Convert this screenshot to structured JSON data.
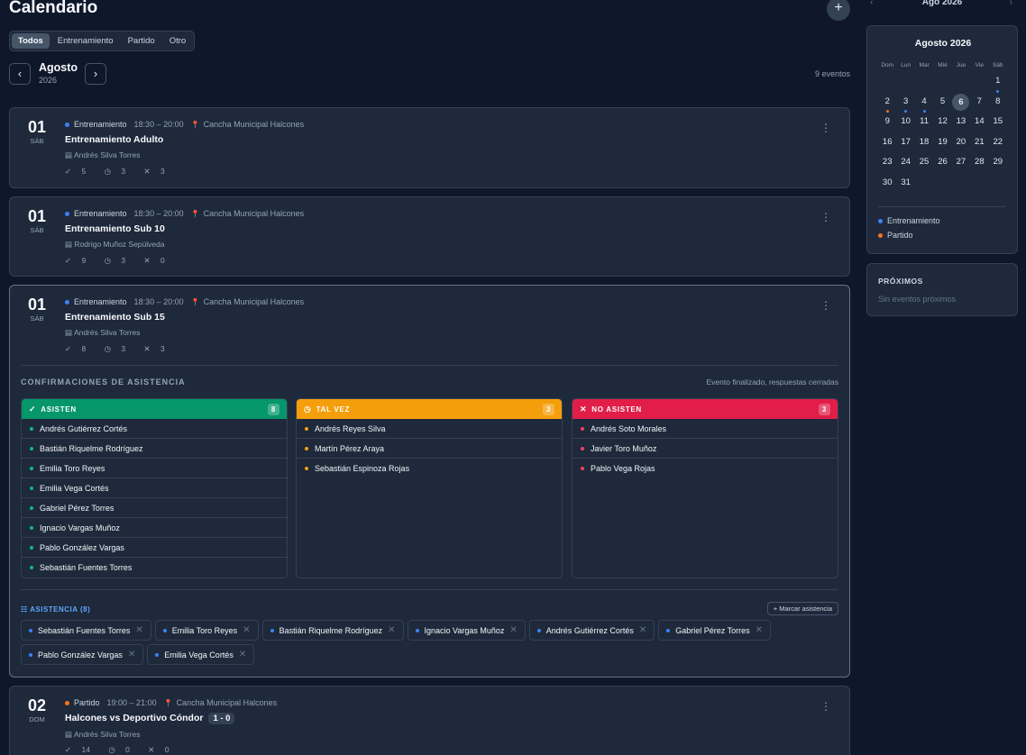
{
  "header": {
    "title": "Calendario",
    "add_label": "+"
  },
  "filters": [
    "Todos",
    "Entrenamiento",
    "Partido",
    "Otro"
  ],
  "nav": {
    "prev": "‹",
    "next": "›",
    "month": "Agosto",
    "year": "2026",
    "count": "9 eventos"
  },
  "colors": {
    "training": "#3b82f6",
    "match": "#f97316",
    "yes": "#059669",
    "maybe": "#f59e0b",
    "no": "#e11d48"
  },
  "events": [
    {
      "day": "01",
      "weekday": "SÁB",
      "type": "Entrenamiento",
      "time": "18:30 – 20:00",
      "place": "Cancha Municipal Halcones",
      "title": "Entrenamiento Adulto",
      "coach": "Andrés Silva Torres",
      "yes": "5",
      "maybe": "3",
      "no": "3"
    },
    {
      "day": "01",
      "weekday": "SÁB",
      "type": "Entrenamiento",
      "time": "18:30 – 20:00",
      "place": "Cancha Municipal Halcones",
      "title": "Entrenamiento Sub 10",
      "coach": "Rodrigo Muñoz Sepúlveda",
      "yes": "9",
      "maybe": "3",
      "no": "0"
    },
    {
      "day": "01",
      "weekday": "SÁB",
      "type": "Entrenamiento",
      "time": "18:30 – 20:00",
      "place": "Cancha Municipal Halcones",
      "title": "Entrenamiento Sub 15",
      "coach": "Andrés Silva Torres",
      "yes": "8",
      "maybe": "3",
      "no": "3"
    },
    {
      "day": "02",
      "weekday": "DOM",
      "type": "Partido",
      "time": "19:00 – 21:00",
      "place": "Cancha Municipal Halcones",
      "title": "Halcones vs Deportivo Cóndor",
      "score": "1 - 0",
      "coach": "Andrés Silva Torres",
      "yes": "14",
      "maybe": "0",
      "no": "0"
    }
  ],
  "confirmations": {
    "title": "CONFIRMACIONES DE ASISTENCIA",
    "note": "Evento finalizado, respuestas cerradas",
    "attending": {
      "label": "ASISTEN",
      "count": "8",
      "names": [
        "Andrés Gutiérrez Cortés",
        "Bastián Riquelme Rodríguez",
        "Emilia Toro Reyes",
        "Emilia Vega Cortés",
        "Gabriel Pérez Torres",
        "Ignacio Vargas Muñoz",
        "Pablo González Vargas",
        "Sebastián Fuentes Torres"
      ]
    },
    "maybe": {
      "label": "TAL VEZ",
      "count": "3",
      "names": [
        "Andrés Reyes Silva",
        "Martín Pérez Araya",
        "Sebastián Espinoza Rojas"
      ]
    },
    "not_attending": {
      "label": "NO ASISTEN",
      "count": "3",
      "names": [
        "Andrés Soto Morales",
        "Javier Toro Muñoz",
        "Pablo Vega Rojas"
      ]
    }
  },
  "attendance": {
    "title": "ASISTENCIA (8)",
    "mark_label": "+ Marcar asistencia",
    "chips": [
      "Sebastián Fuentes Torres",
      "Emilia Toro Reyes",
      "Bastián Riquelme Rodríguez",
      "Ignacio Vargas Muñoz",
      "Andrés Gutiérrez Cortés",
      "Gabriel Pérez Torres",
      "Pablo González Vargas",
      "Emilia Vega Cortés"
    ]
  },
  "mini_calendar": {
    "top_label": "Ago 2026",
    "title": "Agosto 2026",
    "weekdays": [
      "Dom",
      "Lun",
      "Mar",
      "Mié",
      "Jue",
      "Vie",
      "Sáb"
    ],
    "lead_blanks": 6,
    "days": 31,
    "today": 6,
    "markers": {
      "1": [
        "training"
      ],
      "2": [
        "match"
      ],
      "3": [
        "training"
      ],
      "4": [
        "training"
      ]
    },
    "legend": [
      "Entrenamiento",
      "Partido"
    ]
  },
  "upcoming": {
    "title": "PRÓXIMOS",
    "empty": "Sin eventos próximos"
  }
}
